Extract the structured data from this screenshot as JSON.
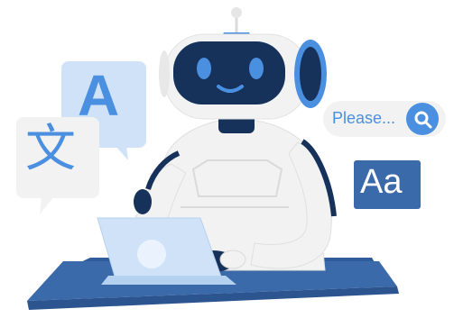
{
  "bubble_a": {
    "letter": "A"
  },
  "bubble_wen": {
    "letter": "文"
  },
  "search_bubble": {
    "text": "Please..."
  },
  "font_card": {
    "text": "Aa"
  },
  "colors": {
    "primary_blue": "#4a8fe0",
    "light_blue": "#cfe2f8",
    "dark_navy": "#16325a",
    "desk_blue": "#3b6aab",
    "robot_white": "#f2f2f2"
  }
}
